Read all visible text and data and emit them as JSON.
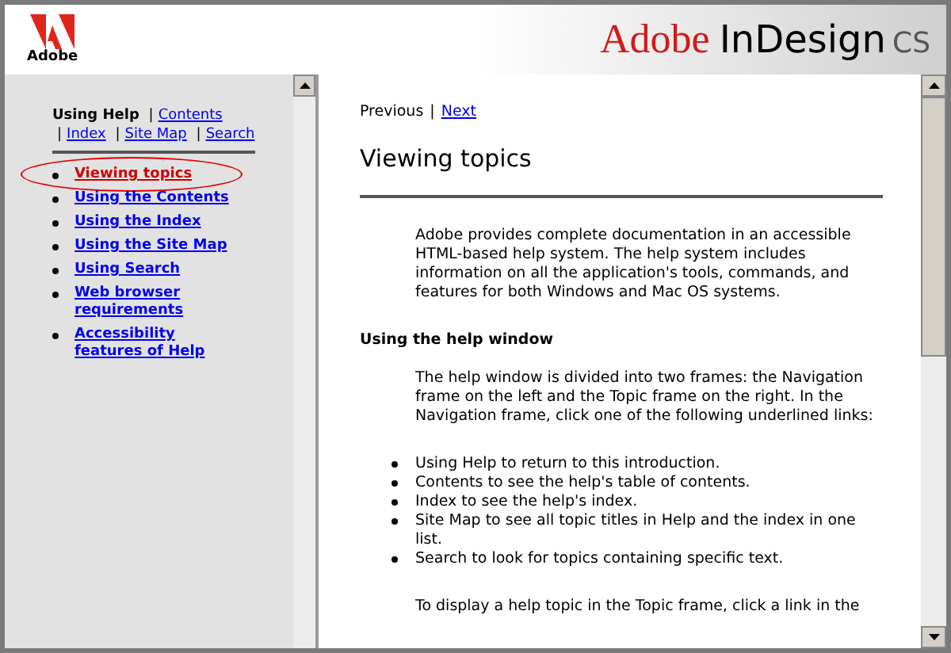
{
  "header": {
    "logo_text": "Adobe",
    "product": {
      "brand": "Adobe",
      "name": "InDesign",
      "edition": "CS"
    }
  },
  "nav": {
    "links": [
      {
        "label": "Using Help",
        "selected": true
      },
      {
        "label": "Contents",
        "selected": false
      },
      {
        "label": "Index",
        "selected": false
      },
      {
        "label": "Site Map",
        "selected": false
      },
      {
        "label": "Search",
        "selected": false
      }
    ],
    "separator": "|",
    "topics": [
      {
        "label": "Viewing topics",
        "selected": true
      },
      {
        "label": "Using the Contents",
        "selected": false
      },
      {
        "label": "Using the Index",
        "selected": false
      },
      {
        "label": "Using the Site Map",
        "selected": false
      },
      {
        "label": "Using Search",
        "selected": false
      },
      {
        "label": "Web browser requirements",
        "selected": false
      },
      {
        "label": "Accessibility features of Help",
        "selected": false
      }
    ]
  },
  "topic": {
    "pager": [
      {
        "label": "Previous",
        "disabled": true
      },
      {
        "label": "Next",
        "disabled": false
      }
    ],
    "title": "Viewing topics",
    "blocks": [
      {
        "kind": "para",
        "text": "Adobe provides complete documentation in an accessible HTML-based help system. The help system includes information on all the application's tools, commands, and features for both Windows and Mac OS systems."
      },
      {
        "kind": "heading",
        "text": "Using the help window"
      },
      {
        "kind": "para",
        "text": "The help window is divided into two frames: the Navigation frame on the left and the Topic frame on the right. In the Navigation frame, click one of the following underlined links:"
      },
      {
        "kind": "list",
        "items": [
          "Using Help to return to this introduction.",
          "Contents to see the help's table of contents.",
          "Index to see the help's index.",
          "Site Map to see all topic titles in Help and the index in one list.",
          "Search to look for topics containing specific text."
        ]
      },
      {
        "kind": "para",
        "text": "To display a help topic in the Topic frame, click a link in the"
      }
    ]
  }
}
